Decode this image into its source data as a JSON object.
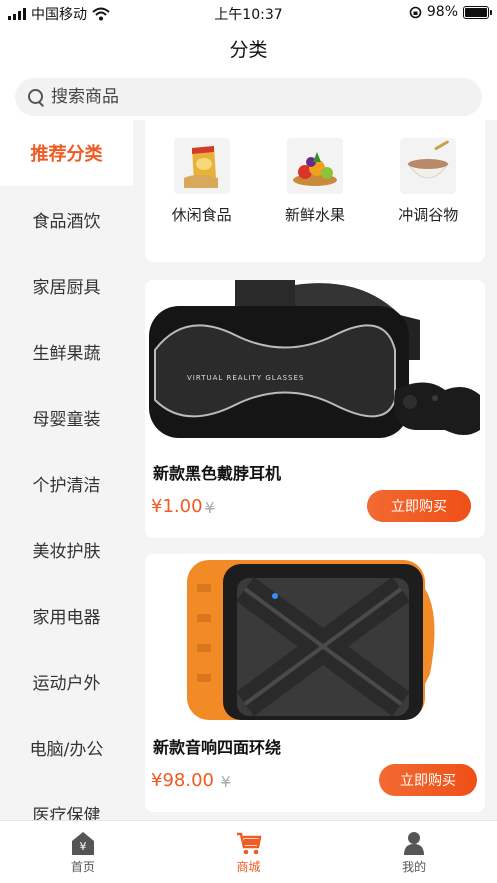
{
  "status": {
    "carrier": "中国移动",
    "time": "上午10:37",
    "battery": "98%",
    "battery_level": 0.98
  },
  "header": {
    "title": "分类"
  },
  "search": {
    "placeholder": "搜索商品"
  },
  "sidebar": {
    "items": [
      {
        "label": "推荐分类",
        "active": true
      },
      {
        "label": "食品酒饮"
      },
      {
        "label": "家居厨具"
      },
      {
        "label": "生鲜果蔬"
      },
      {
        "label": "母婴童装"
      },
      {
        "label": "个护清洁"
      },
      {
        "label": "美妆护肤"
      },
      {
        "label": "家用电器"
      },
      {
        "label": "运动户外"
      },
      {
        "label": "电脑/办公"
      },
      {
        "label": "医疗保健"
      }
    ]
  },
  "subcategories": [
    {
      "label": "休闲食品",
      "icon": "snack-icon"
    },
    {
      "label": "新鲜水果",
      "icon": "fruit-icon"
    },
    {
      "label": "冲调谷物",
      "icon": "cereal-icon"
    }
  ],
  "products": [
    {
      "name": "新款黑色戴脖耳机",
      "price": "¥1.00",
      "old_price": "¥",
      "button": "立即购买",
      "image": "vr-headset-image"
    },
    {
      "name": "新款音响四面环绕",
      "price": "¥98.00",
      "old_price": "¥",
      "button": "立即购买",
      "image": "speaker-image"
    }
  ],
  "tabbar": {
    "items": [
      {
        "label": "首页",
        "icon": "home-icon"
      },
      {
        "label": "商城",
        "icon": "cart-icon",
        "active": true
      },
      {
        "label": "我的",
        "icon": "profile-icon"
      }
    ]
  },
  "colors": {
    "accent": "#f05a23",
    "background": "#f4f4f4"
  }
}
